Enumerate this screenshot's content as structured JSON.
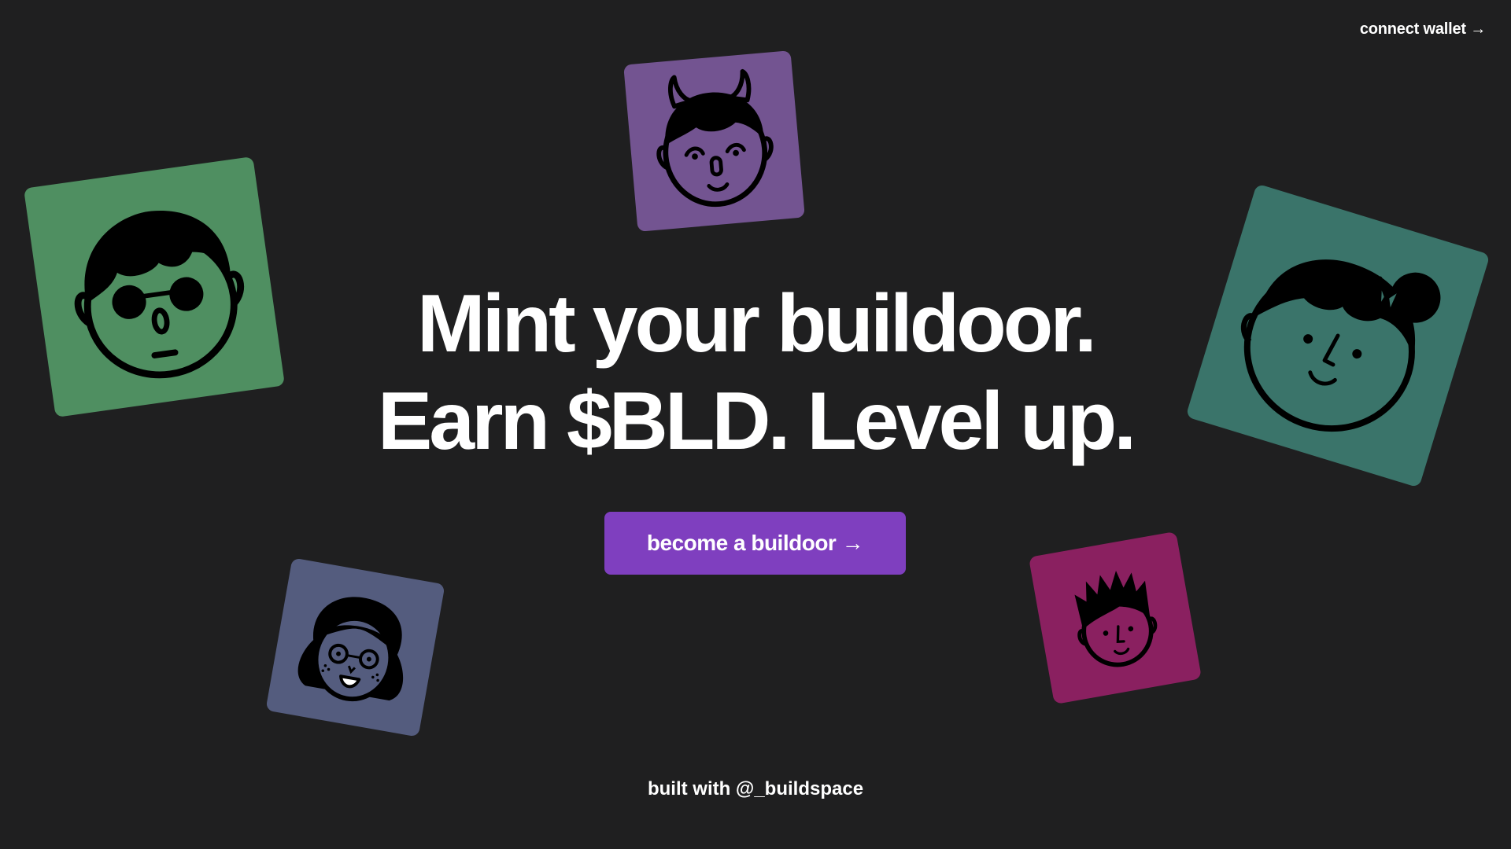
{
  "header": {
    "connect_wallet_label": "connect wallet →"
  },
  "hero": {
    "line1": "Mint your buildoor.",
    "line2": "Earn $BLD. Level up."
  },
  "cta": {
    "label": "become a buildoor →"
  },
  "footer": {
    "text": "built with @_buildspace"
  },
  "colors": {
    "background": "#1f1f20",
    "accent": "#7f3fbf",
    "card_green": "#4f8f61",
    "card_purple": "#735491",
    "card_teal": "#3a746a",
    "card_slate": "#545c7e",
    "card_magenta": "#8a2060"
  },
  "avatars": [
    {
      "icon": "avatar-sunglasses-icon",
      "color": "#4f8f61"
    },
    {
      "icon": "avatar-horns-icon",
      "color": "#735491"
    },
    {
      "icon": "avatar-bow-bun-icon",
      "color": "#3a746a"
    },
    {
      "icon": "avatar-glasses-freckles-icon",
      "color": "#545c7e"
    },
    {
      "icon": "avatar-spiky-hair-icon",
      "color": "#8a2060"
    }
  ]
}
